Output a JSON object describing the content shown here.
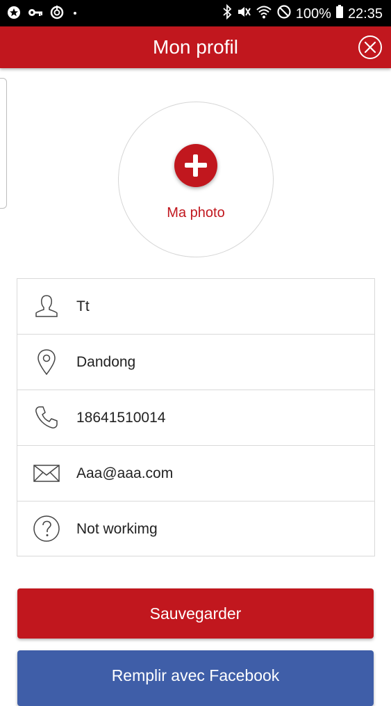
{
  "status_bar": {
    "battery": "100%",
    "time": "22:35",
    "icons": [
      "notification-star-icon",
      "key-icon",
      "sync-icon",
      "dot-icon",
      "bluetooth-icon",
      "mute-icon",
      "wifi-icon",
      "do-not-disturb-icon",
      "battery-icon"
    ]
  },
  "header": {
    "title": "Mon profil",
    "close_icon": "close-circle-icon"
  },
  "photo": {
    "label": "Ma photo",
    "add_icon": "plus-icon"
  },
  "form": {
    "fields": [
      {
        "icon": "person-icon",
        "value": "Tt"
      },
      {
        "icon": "location-pin-icon",
        "value": "Dandong"
      },
      {
        "icon": "phone-icon",
        "value": "18641510014"
      },
      {
        "icon": "envelope-icon",
        "value": "Aaa@aaa.com"
      },
      {
        "icon": "question-icon",
        "value": "Not workimg"
      }
    ]
  },
  "buttons": {
    "save_label": "Sauvegarder",
    "facebook_label": "Remplir avec Facebook"
  },
  "colors": {
    "brand_red": "#c1171e",
    "facebook_blue": "#3f5ea8"
  }
}
